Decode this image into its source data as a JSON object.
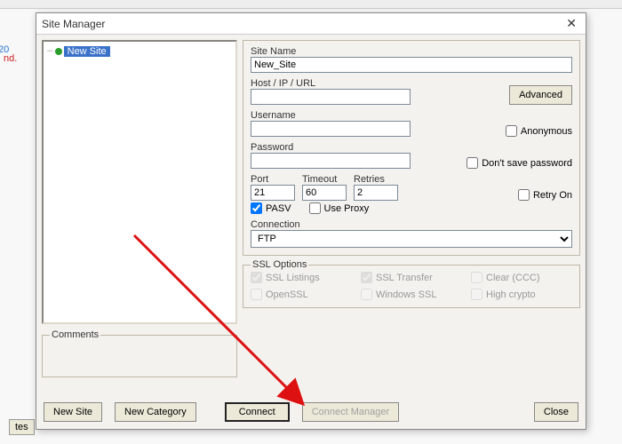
{
  "bg": {
    "left_text": "nd.",
    "left_num": "20",
    "btn": "tes"
  },
  "window": {
    "title": "Site Manager",
    "close": "✕"
  },
  "tree": {
    "items": [
      {
        "label": "New Site"
      }
    ]
  },
  "form": {
    "site_name_label": "Site Name",
    "site_name_value": "New_Site",
    "host_label": "Host / IP / URL",
    "host_value": "",
    "advanced_btn": "Advanced",
    "username_label": "Username",
    "username_value": "",
    "anonymous_label": "Anonymous",
    "password_label": "Password",
    "password_value": "",
    "dont_save_label": "Don't save password",
    "port_label": "Port",
    "port_value": "21",
    "timeout_label": "Timeout",
    "timeout_value": "60",
    "retries_label": "Retries",
    "retries_value": "2",
    "retry_on_label": "Retry On",
    "pasv_label": "PASV",
    "use_proxy_label": "Use Proxy",
    "connection_label": "Connection",
    "connection_value": "FTP"
  },
  "comments_label": "Comments",
  "ssl": {
    "title": "SSL Options",
    "listings": "SSL Listings",
    "transfer": "SSL Transfer",
    "clear": "Clear (CCC)",
    "openssl": "OpenSSL",
    "winssl": "Windows SSL",
    "highcrypto": "High crypto"
  },
  "buttons": {
    "new_site": "New Site",
    "new_category": "New Category",
    "connect": "Connect",
    "connect_manager": "Connect Manager",
    "close": "Close"
  }
}
